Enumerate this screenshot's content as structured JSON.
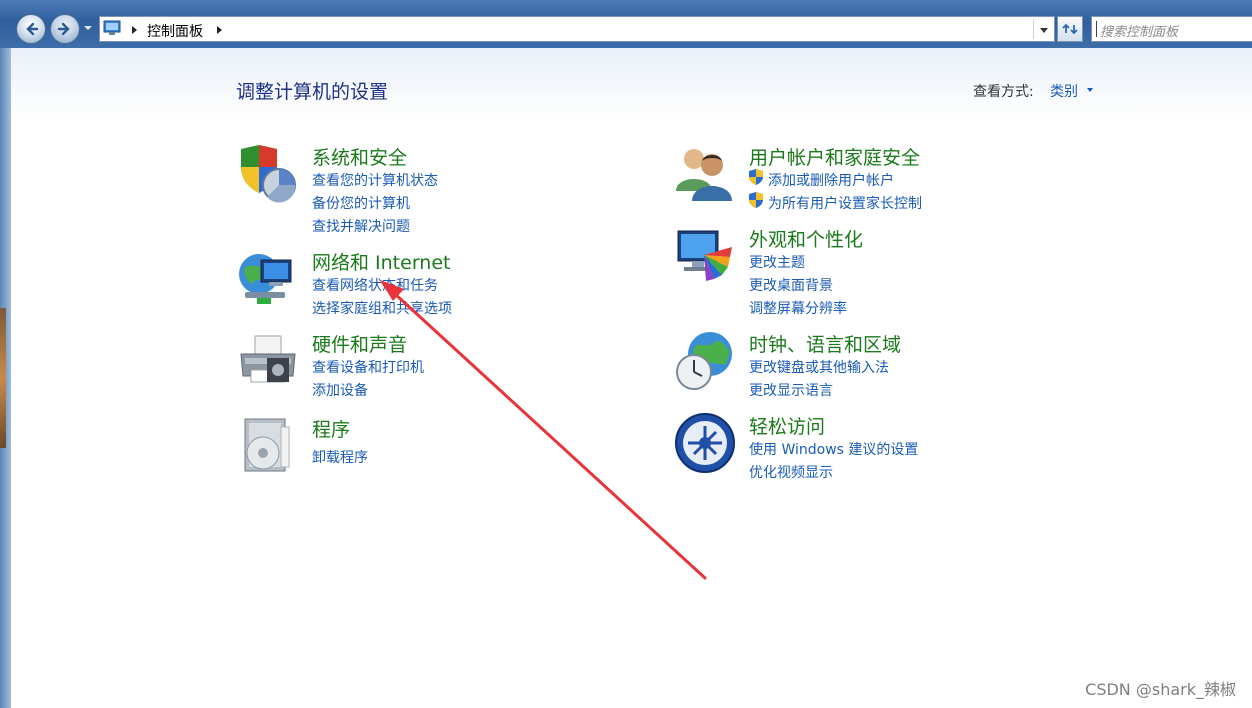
{
  "address": {
    "breadcrumb": "控制面板",
    "search_placeholder": "搜索控制面板"
  },
  "header": {
    "title": "调整计算机的设置",
    "view_by_label": "查看方式:",
    "view_by_value": "类别"
  },
  "categories": {
    "system": {
      "title": "系统和安全",
      "links": [
        "查看您的计算机状态",
        "备份您的计算机",
        "查找并解决问题"
      ]
    },
    "network": {
      "title": "网络和 Internet",
      "links": [
        "查看网络状态和任务",
        "选择家庭组和共享选项"
      ]
    },
    "hardware": {
      "title": "硬件和声音",
      "links": [
        "查看设备和打印机",
        "添加设备"
      ]
    },
    "programs": {
      "title": "程序",
      "links": [
        "卸载程序"
      ]
    },
    "users": {
      "title": "用户帐户和家庭安全",
      "links": [
        "添加或删除用户帐户",
        "为所有用户设置家长控制"
      ]
    },
    "appearance": {
      "title": "外观和个性化",
      "links": [
        "更改主题",
        "更改桌面背景",
        "调整屏幕分辨率"
      ]
    },
    "clock": {
      "title": "时钟、语言和区域",
      "links": [
        "更改键盘或其他输入法",
        "更改显示语言"
      ]
    },
    "ease": {
      "title": "轻松访问",
      "links": [
        "使用 Windows 建议的设置",
        "优化视频显示"
      ]
    }
  },
  "colors": {
    "category_title": "#1b7a1b",
    "link": "#1a5bb8",
    "annotation_arrow": "#e8333a"
  },
  "watermark": "CSDN @shark_辣椒"
}
